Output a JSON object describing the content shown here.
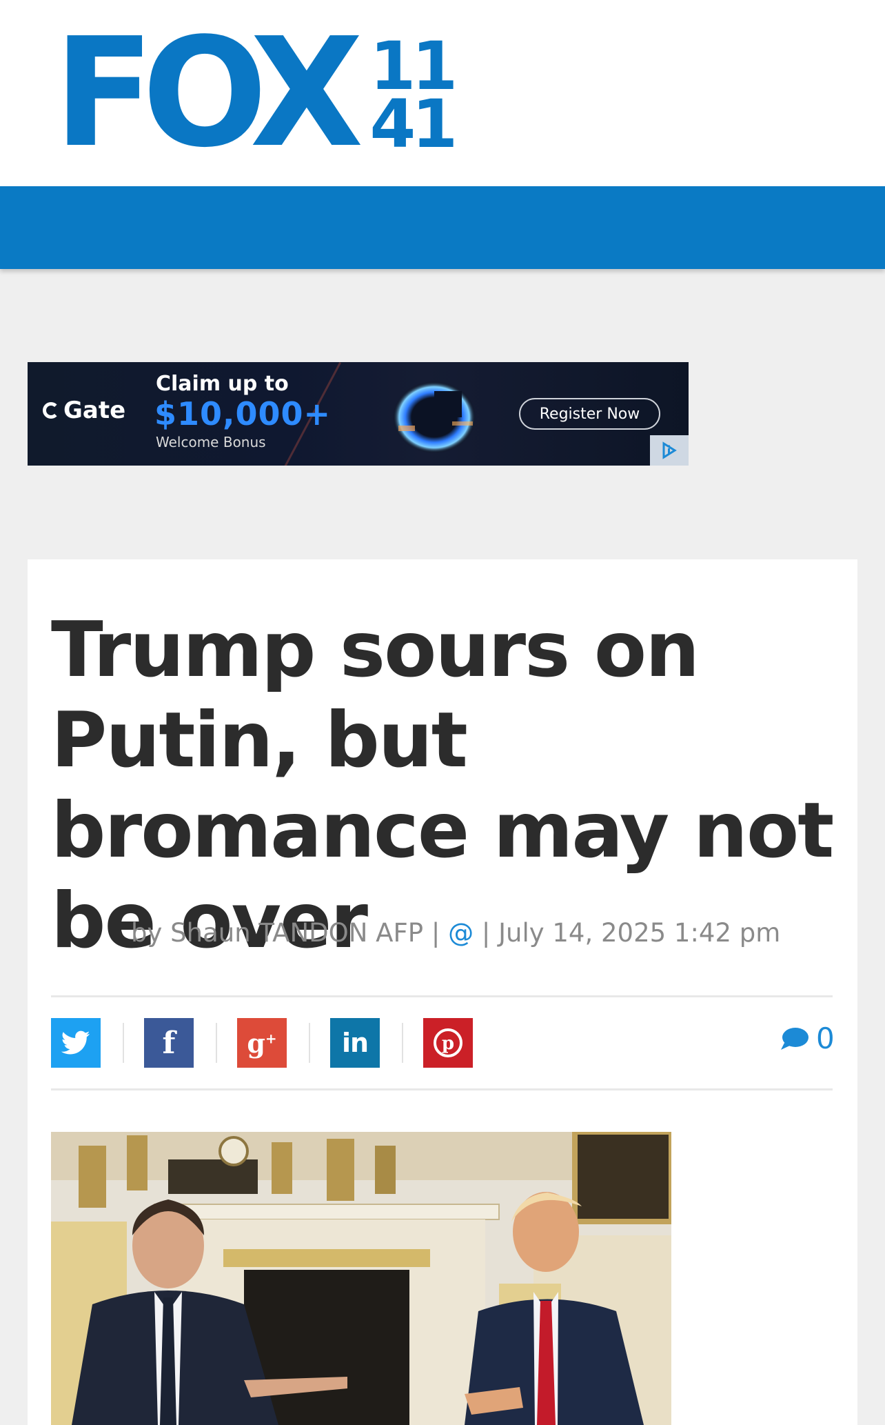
{
  "header": {
    "logo_text": "FOX",
    "logo_number_top": "11",
    "logo_number_bottom": "41"
  },
  "ad": {
    "brand": "Gate",
    "claim": "Claim up to",
    "amount": "$10,000+",
    "bonus": "Welcome Bonus",
    "cta": "Register Now",
    "adchoices_icon": "adchoices-icon"
  },
  "article": {
    "title": "Trump sours on Putin, but bromance may not be over",
    "byline": {
      "author": "by Shaun TANDON AFP",
      "sep1": " | ",
      "at": "@",
      "sep2": " | ",
      "date": "July 14, 2025 1:42 pm"
    },
    "share": [
      {
        "network": "twitter",
        "icon": "twitter-icon",
        "color": "#1da1f2"
      },
      {
        "network": "facebook",
        "icon": "facebook-icon",
        "color": "#3b5998"
      },
      {
        "network": "google-plus",
        "icon": "google-plus-icon",
        "color": "#dd4b39"
      },
      {
        "network": "linkedin",
        "icon": "linkedin-icon",
        "color": "#0e76a8"
      },
      {
        "network": "pinterest",
        "icon": "pinterest-icon",
        "color": "#cb2027"
      }
    ],
    "comment_count": "0",
    "colors": {
      "brand_blue": "#0a77c4",
      "link_blue": "#1c8ad6",
      "headline": "#2c2c2c",
      "meta_gray": "#8a8a8a"
    }
  }
}
